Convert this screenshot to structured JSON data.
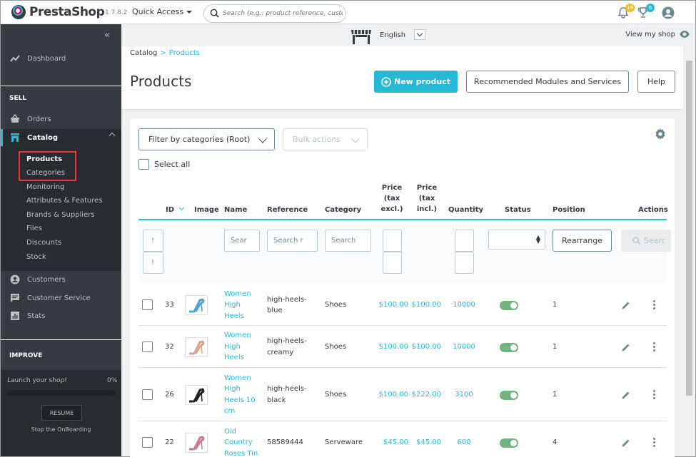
{
  "header": {
    "logo": "PrestaShop",
    "version": "1.7.8.2",
    "quick_access": "Quick Access",
    "search_placeholder": "Search (e.g.: product reference, custon",
    "notifications_count": "19",
    "trophy_count": "6"
  },
  "sidebar": {
    "dashboard": "Dashboard",
    "sell_section": "SELL",
    "orders": "Orders",
    "catalog": "Catalog",
    "catalog_submenu": [
      "Products",
      "Categories",
      "Monitoring",
      "Attributes & Features",
      "Brands & Suppliers",
      "Files",
      "Discounts",
      "Stock"
    ],
    "customers": "Customers",
    "customer_service": "Customer Service",
    "stats": "Stats",
    "improve_section": "IMPROVE",
    "launch_text": "Launch your shop!",
    "launch_percent": "0%",
    "launch_progress": 0,
    "resume_button": "RESUME",
    "stop_onboarding": "Stop the OnBoarding"
  },
  "subheader": {
    "language": "English",
    "view_my_shop": "View my shop"
  },
  "page": {
    "breadcrumb_parent": "Catalog",
    "breadcrumb_separator": ">",
    "breadcrumb_current": "Products",
    "title": "Products",
    "new_product_button": "New product",
    "recommended_button": "Recommended Modules and Services",
    "help_button": "Help"
  },
  "toolbar": {
    "filter_categories": "Filter by categories (Root)",
    "bulk_actions": "Bulk actions",
    "select_all": "Select all"
  },
  "table": {
    "headers": {
      "id": "ID",
      "image": "Image",
      "name": "Name",
      "reference": "Reference",
      "category": "Category",
      "price_excl_1": "Price",
      "price_excl_2": "(tax",
      "price_excl_3": "excl.)",
      "price_incl_1": "Price",
      "price_incl_2": "(tax",
      "price_incl_3": "incl.)",
      "quantity": "Quantity",
      "status": "Status",
      "position": "Position",
      "actions": "Actions"
    },
    "filters": {
      "name_placeholder": "Sear",
      "reference_placeholder": "Search r",
      "category_placeholder": "Search",
      "rearrange_button": "Rearrange",
      "search_button": "Searc"
    },
    "rows": [
      {
        "id": "33",
        "name_lines": [
          "Women",
          "High",
          "Heels"
        ],
        "reference_lines": [
          "high-heels-",
          "blue"
        ],
        "category": "Shoes",
        "price_excl": "$100.00",
        "price_incl": "$100.00",
        "quantity": "10000",
        "status": true,
        "position": "1",
        "image_color": "#4fa3d9"
      },
      {
        "id": "32",
        "name_lines": [
          "Women",
          "High",
          "Heels"
        ],
        "reference_lines": [
          "high-heels-",
          "creamy"
        ],
        "category": "Shoes",
        "price_excl": "$100.00",
        "price_incl": "$100.00",
        "quantity": "10000",
        "status": true,
        "position": "1",
        "image_color": "#d9a48a"
      },
      {
        "id": "26",
        "name_lines": [
          "Women",
          "High",
          "Heels 10",
          "cm"
        ],
        "reference_lines": [
          "high-heels-",
          "black"
        ],
        "category": "Shoes",
        "price_excl": "$100.00",
        "price_incl": "$222.00",
        "quantity": "3100",
        "status": true,
        "position": "1",
        "image_color": "#222222"
      },
      {
        "id": "22",
        "name_lines": [
          "Old",
          "Country",
          "Roses Tin"
        ],
        "reference_lines": [
          "58589444"
        ],
        "category": "Serveware",
        "price_excl": "$45.00",
        "price_incl": "$45.00",
        "quantity": "600",
        "status": true,
        "position": "4",
        "image_color": "#c97c8c"
      }
    ]
  },
  "colors": {
    "accent": "#25b9d7",
    "sidebar_bg": "#363a41",
    "status_on": "#70b580",
    "highlight_box": "#e8383d"
  }
}
